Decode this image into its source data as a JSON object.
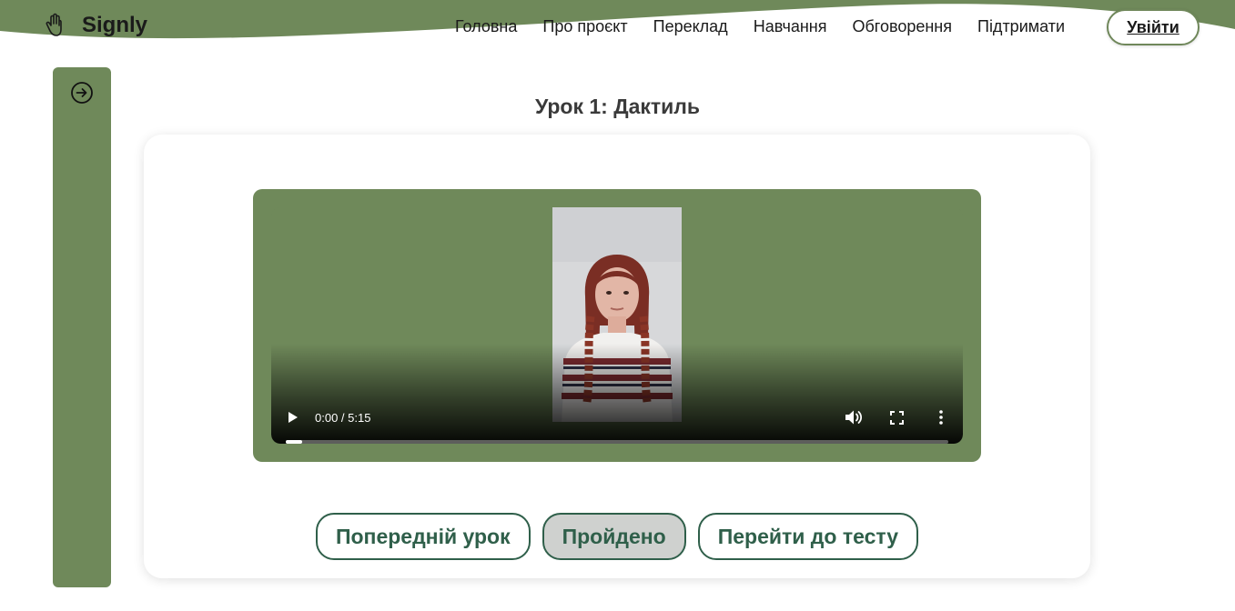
{
  "brand": {
    "name": "Signly",
    "icon": "hand-icon",
    "accent": "#6f895a"
  },
  "nav": {
    "items": [
      "Головна",
      "Про проєкт",
      "Переклад",
      "Навчання",
      "Обговорення",
      "Підтримати"
    ],
    "login_label": "Увійти"
  },
  "sidebar": {
    "toggle_icon": "arrow-right-circle-icon",
    "color": "#6f895a"
  },
  "lesson": {
    "title": "Урок 1: Дактиль"
  },
  "video": {
    "current_time": "0:00",
    "duration": "5:15",
    "time_display": "0:00 / 5:15",
    "progress_fraction": 0.025,
    "icons": [
      "play-icon",
      "volume-icon",
      "fullscreen-icon",
      "more-vert-icon"
    ]
  },
  "actions": {
    "previous_label": "Попередній урок",
    "done_label": "Пройдено",
    "test_label": "Перейти до тесту"
  }
}
